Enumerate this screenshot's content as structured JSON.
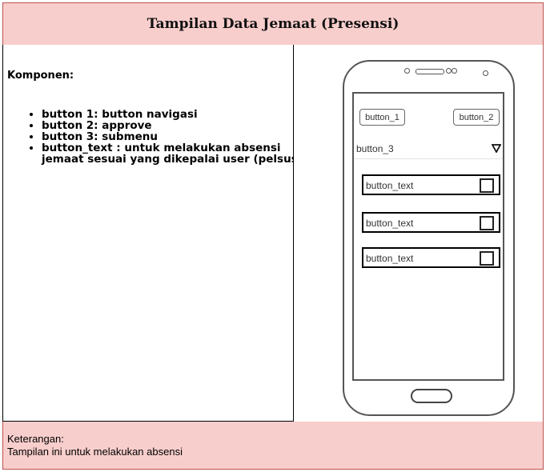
{
  "header": {
    "title": "Tampilan Data Jemaat (Presensi)"
  },
  "components": {
    "title": "Komponen:",
    "items": [
      "button 1: button navigasi",
      "button 2: approve",
      "button 3: submenu",
      "button_text : untuk melakukan absensi jemaat sesuai yang dikepalai user (pelsus)"
    ]
  },
  "phone": {
    "button_1": "button_1",
    "button_2": "button_2",
    "submenu_label": "button_3",
    "rows": [
      "button_text",
      "button_text",
      "button_text"
    ]
  },
  "footer": {
    "title": "Keterangan:",
    "text": "Tampilan ini untuk melakukan absensi"
  }
}
